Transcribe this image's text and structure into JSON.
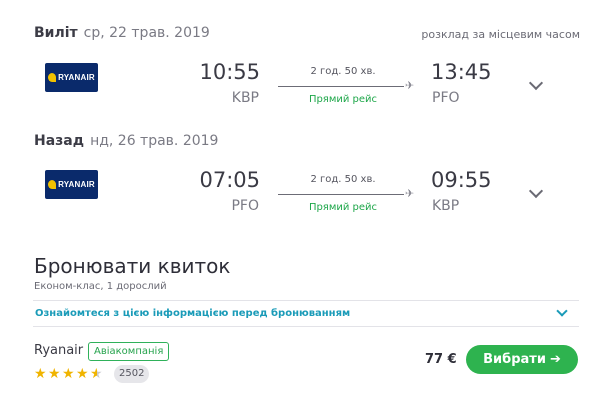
{
  "local_time_note": "розклад за місцевим часом",
  "segments": [
    {
      "direction": "Виліт",
      "date": "ср, 22 трав. 2019",
      "airline_logo_text": "RYANAIR",
      "dep_time": "10:55",
      "dep_code": "KBP",
      "duration": "2 год. 50 хв.",
      "direct_label": "Прямий рейс",
      "arr_time": "13:45",
      "arr_code": "PFO"
    },
    {
      "direction": "Назад",
      "date": "нд, 26 трав. 2019",
      "airline_logo_text": "RYANAIR",
      "dep_time": "07:05",
      "dep_code": "PFO",
      "duration": "2 год. 50 хв.",
      "direct_label": "Прямий рейс",
      "arr_time": "09:55",
      "arr_code": "KBP"
    }
  ],
  "booking": {
    "title": "Бронювати квиток",
    "subtitle": "Економ-клас, 1 дорослий",
    "info_link": "Ознайомтеся з цією інформацією перед бронюванням"
  },
  "offer": {
    "airline": "Ryanair",
    "badge": "Авіакомпанія",
    "rating": 4.5,
    "review_count": "2502",
    "price": "77 €",
    "select_label": "Вибрати",
    "select_arrow": "➔"
  },
  "colors": {
    "accent_green": "#2eb34f",
    "link_teal": "#1a9bb8",
    "logo_navy": "#0a2a6b",
    "star": "#f0b400"
  }
}
